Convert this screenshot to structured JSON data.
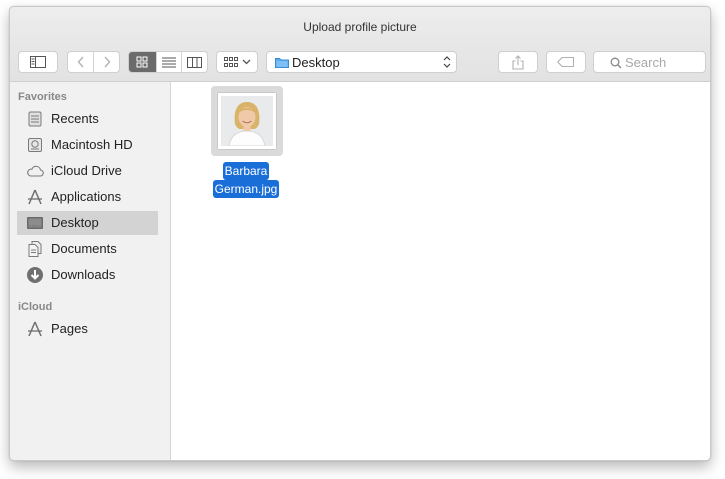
{
  "window": {
    "title": "Upload profile picture"
  },
  "toolbar": {
    "location": "Desktop",
    "search_placeholder": "Search"
  },
  "sidebar": {
    "favorites_heading": "Favorites",
    "favorites": [
      {
        "label": "Recents",
        "icon": "recents-icon"
      },
      {
        "label": "Macintosh HD",
        "icon": "hard-drive-icon"
      },
      {
        "label": "iCloud Drive",
        "icon": "cloud-icon"
      },
      {
        "label": "Applications",
        "icon": "applications-icon"
      },
      {
        "label": "Desktop",
        "icon": "desktop-icon",
        "selected": true
      },
      {
        "label": "Documents",
        "icon": "documents-icon"
      },
      {
        "label": "Downloads",
        "icon": "downloads-icon"
      }
    ],
    "icloud_heading": "iCloud",
    "icloud": [
      {
        "label": "Pages",
        "icon": "pages-icon"
      }
    ]
  },
  "files": [
    {
      "name_line1": "Barbara",
      "name_line2": "German.jpg",
      "selected": true
    }
  ],
  "colors": {
    "selection_blue": "#1a6ed8",
    "sidebar_bg": "#f1f1f1",
    "sidebar_selected": "#d3d3d3"
  }
}
